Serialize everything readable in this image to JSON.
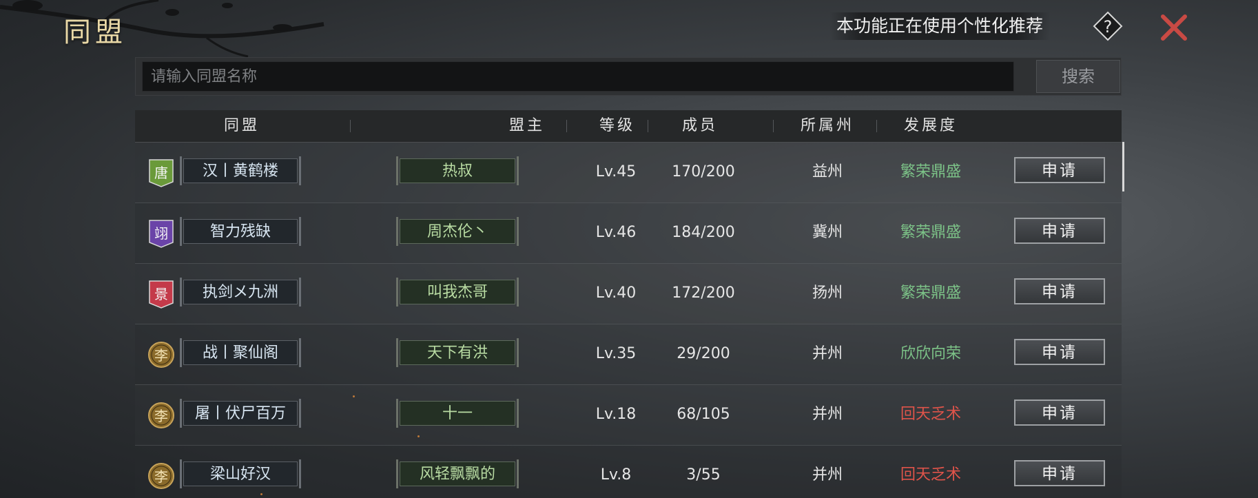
{
  "header": {
    "title": "同盟",
    "notice": "本功能正在使用个性化推荐",
    "help_icon": "question-mark-diamond-icon",
    "close_icon": "close-x-icon"
  },
  "search": {
    "placeholder": "请输入同盟名称",
    "value": "",
    "button_label": "搜索"
  },
  "table": {
    "columns": [
      "同盟",
      "盟主",
      "等级",
      "成员",
      "所属州",
      "发展度"
    ],
    "rows": [
      {
        "badge": "唐",
        "badge_color": "#6a9a3a",
        "badge_shape": "banner",
        "name": "汉丨黄鹤楼",
        "leader": "热叔",
        "level": "Lv.45",
        "members": "170/200",
        "state": "益州",
        "development": "繁荣鼎盛",
        "dev_color": "#7cc287",
        "action": "申请"
      },
      {
        "badge": "翊",
        "badge_color": "#6a43a8",
        "badge_shape": "banner",
        "name": "智力残缺",
        "leader": "周杰伦丶",
        "level": "Lv.46",
        "members": "184/200",
        "state": "冀州",
        "development": "繁荣鼎盛",
        "dev_color": "#7cc287",
        "action": "申请"
      },
      {
        "badge": "景",
        "badge_color": "#c43a4a",
        "badge_shape": "banner",
        "name": "执剑メ九洲",
        "leader": "叫我杰哥",
        "level": "Lv.40",
        "members": "172/200",
        "state": "扬州",
        "development": "繁荣鼎盛",
        "dev_color": "#7cc287",
        "action": "申请"
      },
      {
        "badge": "李",
        "badge_color": "#8a6a2a",
        "badge_shape": "coin",
        "name": "战丨聚仙阁",
        "leader": "天下有洪",
        "level": "Lv.35",
        "members": "29/200",
        "state": "并州",
        "development": "欣欣向荣",
        "dev_color": "#7cc287",
        "action": "申请"
      },
      {
        "badge": "李",
        "badge_color": "#8a6a2a",
        "badge_shape": "coin",
        "name": "屠丨伏尸百万",
        "leader": "十一",
        "level": "Lv.18",
        "members": "68/105",
        "state": "并州",
        "development": "回天乏术",
        "dev_color": "#e0544a",
        "action": "申请"
      },
      {
        "badge": "李",
        "badge_color": "#8a6a2a",
        "badge_shape": "coin",
        "name": "梁山好汉",
        "leader": "风轻飘飘的",
        "level": "Lv.8",
        "members": "3/55",
        "state": "并州",
        "development": "回天乏术",
        "dev_color": "#e0544a",
        "action": "申请"
      }
    ]
  }
}
